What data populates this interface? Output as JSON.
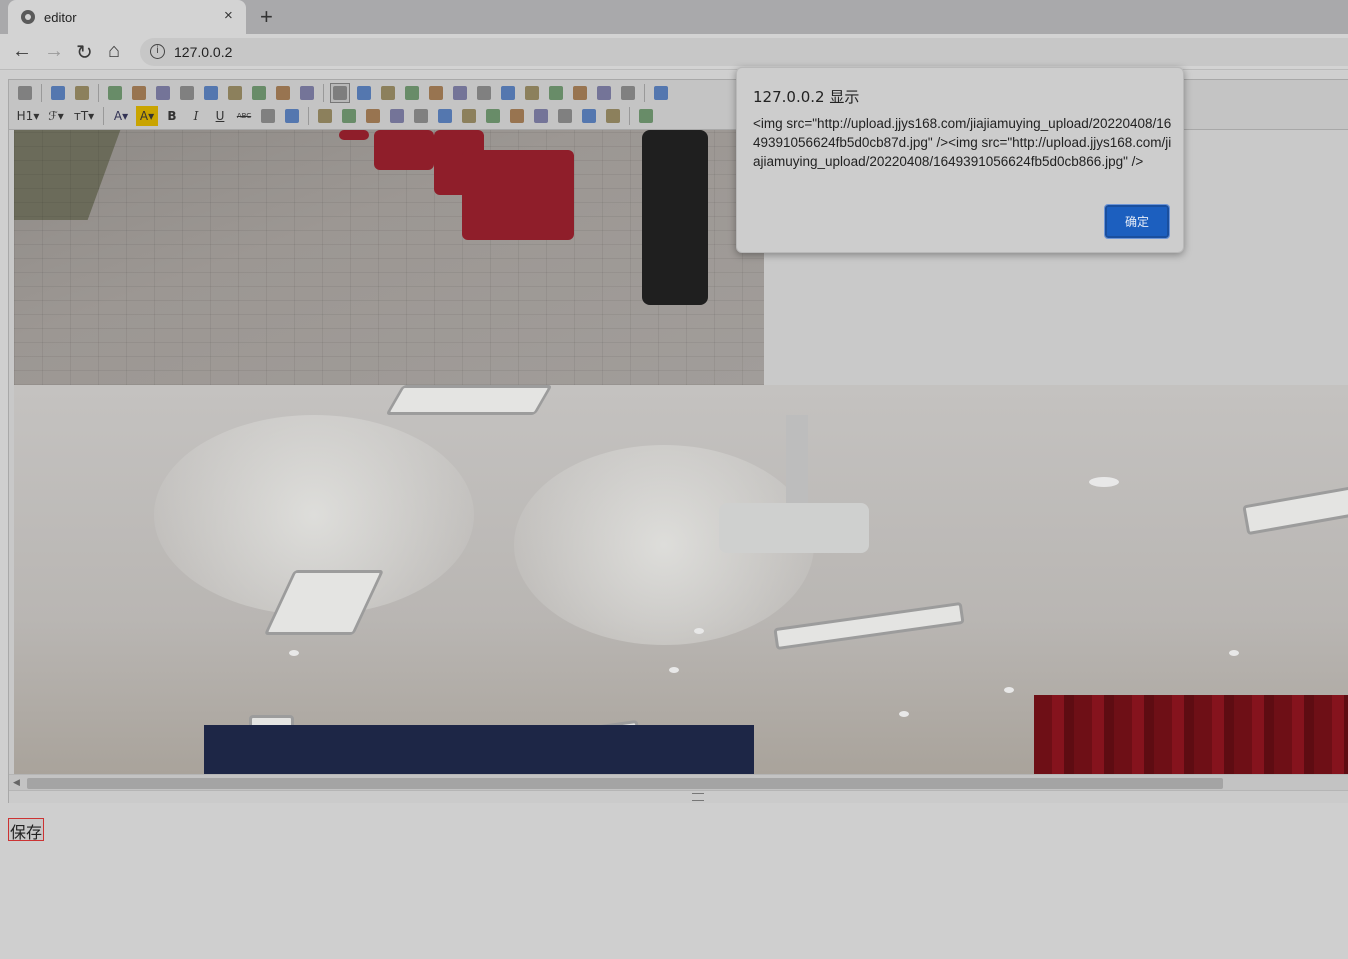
{
  "browser": {
    "tab_title": "editor",
    "tab_close": "×",
    "new_tab": "+",
    "url": "127.0.0.2",
    "nav": {
      "back": "←",
      "forward": "→",
      "reload": "↻",
      "home": "⌂",
      "info": "i"
    }
  },
  "toolbar": {
    "row1": [
      "source-icon",
      "undo-icon",
      "redo-icon",
      "preview-icon",
      "print-icon",
      "template-icon",
      "code-icon",
      "cut-icon",
      "copy-icon",
      "paste-icon",
      "paste-plain-icon",
      "paste-word-icon",
      "align-left-icon",
      "align-center-icon",
      "align-right-icon",
      "align-justify-icon",
      "ordered-list-icon",
      "unordered-list-icon",
      "indent-icon",
      "outdent-icon",
      "subscript-icon",
      "superscript-icon",
      "clear-format-icon",
      "select-all-icon",
      "cursor-icon",
      "fullscreen-icon"
    ],
    "row2_labels": {
      "heading": "H1▾",
      "font": "ℱ▾",
      "fontsize": "ᴛT▾",
      "forecolor": "A▾",
      "hilite": "A▾",
      "bold": "B",
      "italic": "I",
      "underline": "U",
      "strike": "ABC"
    },
    "row2_icons": [
      "line-height-icon",
      "eraser-icon",
      "image-icon",
      "multi-image-icon",
      "flash-icon",
      "media-icon",
      "attachment-icon",
      "table-icon",
      "hr-icon",
      "emoticon-icon",
      "map-icon",
      "pagebreak-icon",
      "anchor-icon",
      "link-icon",
      "unlink-icon",
      "about-icon"
    ]
  },
  "editor": {
    "save_label": "保存"
  },
  "dialog": {
    "title": "127.0.0.2 显示",
    "message": "<img src=\"http://upload.jjys168.com/jiajiamuying_upload/20220408/1649391056624fb5d0cb87d.jpg\" /><img src=\"http://upload.jjys168.com/jiajiamuying_upload/20220408/1649391056624fb5d0cb866.jpg\" />",
    "ok_label": "确定"
  }
}
